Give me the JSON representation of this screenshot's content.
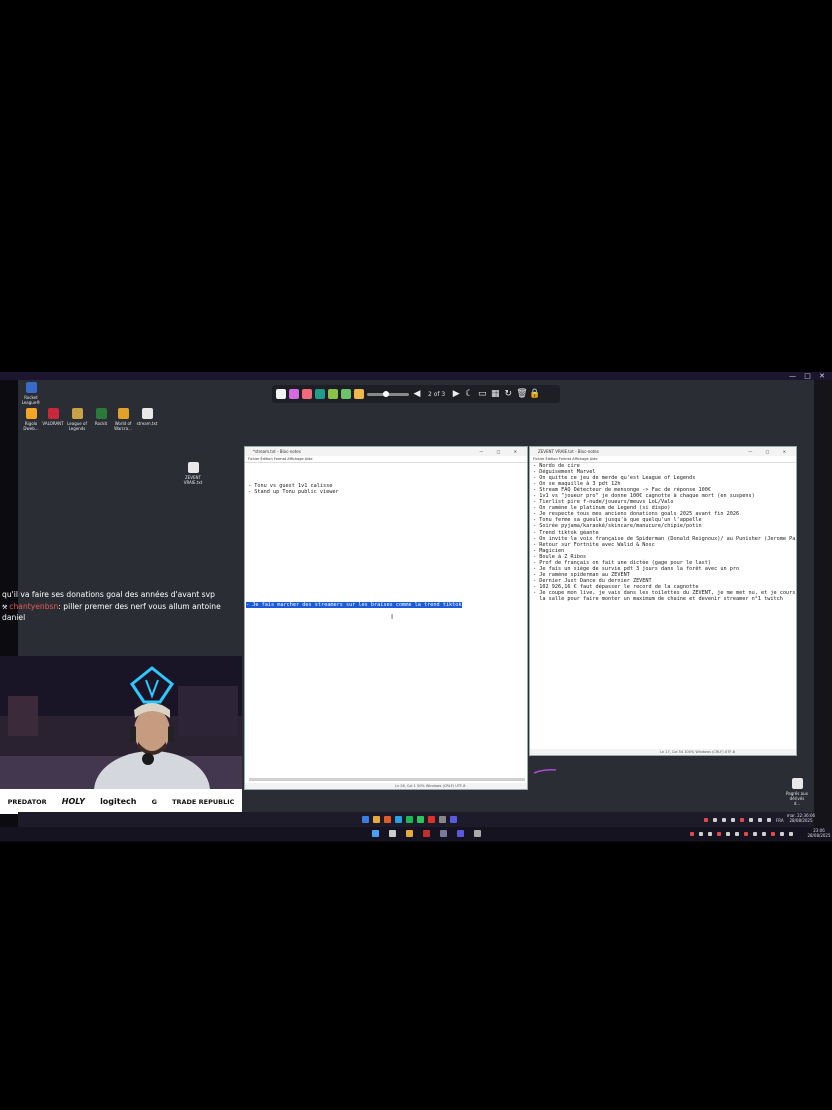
{
  "stream_frame": {
    "window_controls": "— □ ✕"
  },
  "desktop_icons": [
    {
      "label": "Rocket League®",
      "icon": "rocket-league-icon",
      "color": "#3a6ac8"
    },
    {
      "label": "Rigolo Dweb...",
      "icon": "folder-icon",
      "color": "#f2a526"
    },
    {
      "label": "VALORANT",
      "icon": "valorant-icon",
      "color": "#c8283c"
    },
    {
      "label": "League of Legends",
      "icon": "league-icon",
      "color": "#c7a248"
    },
    {
      "label": "Rockit",
      "icon": "rockit-icon",
      "color": "#2c7a3a"
    },
    {
      "label": "World of Warcra...",
      "icon": "wow-icon",
      "color": "#e0a22a"
    },
    {
      "label": "stream.txt",
      "icon": "text-file-icon",
      "color": "#e8e8e8"
    },
    {
      "label": "ZEVENT VRAIE.txt",
      "icon": "text-file-icon",
      "color": "#e8e8e8"
    },
    {
      "label": "Pagrés aux dérivés d...",
      "icon": "text-file-icon",
      "color": "#e8e8e8"
    }
  ],
  "toolbar": {
    "page_indicator": "2 of 3",
    "colors": [
      "#f2f2f2",
      "#d46ae0",
      "#f06a7a",
      "#1e9c8c",
      "#8bc34a",
      "#6ec26a",
      "#f0b84a"
    ]
  },
  "notepad_left": {
    "title": "*stream.txt - Bloc-notes",
    "menu": "Fichier  Édition  Format  Affichage  Aide",
    "lines": [
      "",
      "",
      "",
      "- Tonu vs guest 1v1 calisse",
      "- Stand up Tonu public viewer"
    ],
    "selected_line": "- Je fais marcher des streamers sur les braises comme la trend tiktok",
    "status": "Ln 26, Col 1        50%     Windows (CRLF)      UTF-8"
  },
  "notepad_right": {
    "title": "ZEVENT VRAIE.txt - Bloc-notes",
    "menu": "Fichier  Édition  Format  Affichage  Aide",
    "lines": [
      "- Nordo de cire",
      "- Déguisement Marvel",
      "- On quitte ce jeu de merde qu'est League of Legends",
      "- On se maquille à 3 pdt 12h",
      "- Stream FAQ Détecteur de mensonge -> Fac de réponse 100€",
      "- 1v1 vs \"joueur pro\" je donne 100€ cagnotte à chaque mort (en suspens)",
      "- Tierlist pire f-nude/joueurs/meuvs LoL/Valo",
      "- On ramène le platinum de Legend (si dispo)",
      "- Je respecte tous mes anciens donations goals 2025 avant fin 2026",
      "- Tonu ferme sa gueule jusqu'à que quelqu'un l'appelle",
      "- Soirée pyjama/karaoké/skincare/manucure/chipie/potin",
      "- Trend tiktok géante",
      "- On invite la voix française de Spiderman (Donald Reignoux)/ au Punisher (Jerome Pa",
      "- Retour sur Fortnite avec Walid & Nosc",
      "- Magicien",
      "- Boule à Z Ribos",
      "- Prof de français on fait une dictée (gage pour le last)",
      "- Je fais un siège de survie pdt 3 jours dans la forêt avec un pro",
      "- Je ramène spiderman au ZEVENT",
      "- Dernier Just Dance du dernier ZEVENT",
      "- 102 926,16 € faut dépasser le record de la cagnotte",
      "- Je coupe mon live, je vais dans les toilettes du ZEVENT, je me met nu, et je cours",
      "  la salle pour faire monter un maximum de chaine et devenir streamer n°1 twitch"
    ],
    "status": "Ln 17, Col 54        100%     Windows (CRLF)      UTF-8"
  },
  "chat": [
    {
      "user": "",
      "text": "qu'il va faire ses donations goal des années d'avant svp"
    },
    {
      "user": "chantyenbsn",
      "text": "piller premer des nerf vous allum antoine daniel"
    }
  ],
  "sponsors": [
    "PREDATOR",
    "HOLY",
    "logitech",
    "G",
    "TRADE REPUBLIC"
  ],
  "tray": {
    "lang": "FRA",
    "time_top": "mar. 22:36:06",
    "date_top": "28/08/2025",
    "time_bottom": "23:06",
    "date_bottom": "28/08/2025"
  }
}
